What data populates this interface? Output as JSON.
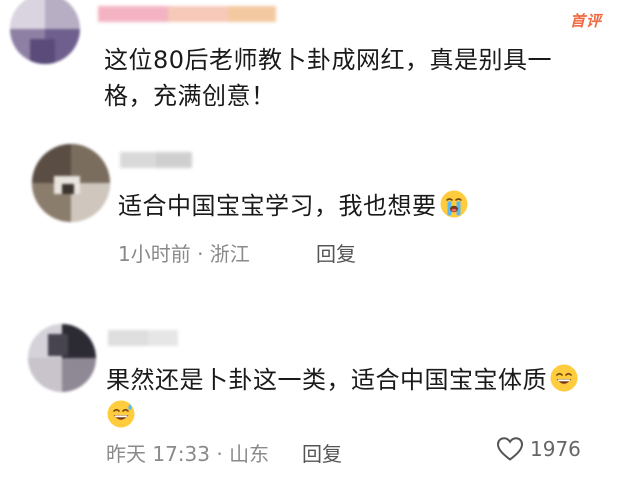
{
  "comments": [
    {
      "badge": "首评",
      "text_line1": "这位80后老师教卜卦成网红，真是别具一",
      "text_line2": "格，充满创意！"
    },
    {
      "text": "适合中国宝宝学习，我也想要",
      "emoji": "loudly-crying-face",
      "time_location": "1小时前 · 浙江",
      "reply_label": "回复"
    },
    {
      "text": "果然还是卜卦这一类，适合中国宝宝体质",
      "emoji": "grinning-sweat-face",
      "time_location": "昨天 17:33 · 山东",
      "reply_label": "回复",
      "like_count": "1976"
    }
  ],
  "colors": {
    "badge": "#ef6b43",
    "meta_text": "#8a8a8a",
    "body_text": "#1a1a1a"
  }
}
